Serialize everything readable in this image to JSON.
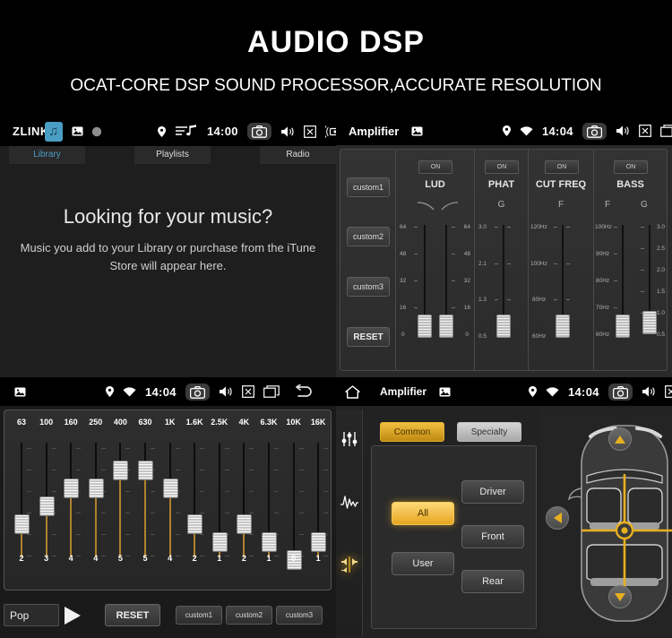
{
  "header": {
    "title": "AUDIO  DSP",
    "subtitle": "OCAT-CORE DSP SOUND PROCESSOR,ACCURATE RESOLUTION"
  },
  "colors": {
    "accent_gold": "#e7a520",
    "accent_blue": "#4a9ec4",
    "panel_bg": "#2b2b2b",
    "status_bg": "#000000",
    "fader_gold": "#b0822e"
  },
  "panel_music": {
    "app_name": "ZLINK",
    "badge_icon": "music-note-icon",
    "statusbar": {
      "time": "14:00",
      "icons": [
        "image-icon",
        "record-dot-icon",
        "location-pin-icon",
        "playlist-icon",
        "camera-icon",
        "speaker-icon",
        "close-box-icon",
        "radio-icon",
        "eject-icon"
      ]
    },
    "tabs": [
      {
        "label": "Library",
        "active": true
      },
      {
        "label": "Playlists",
        "active": false
      },
      {
        "label": "Radio",
        "active": false
      }
    ],
    "empty_state": {
      "heading": "Looking for your music?",
      "body": "Music you add to your Library or purchase from the iTune Store will appear here."
    }
  },
  "panel_dsp": {
    "title": "Amplifier",
    "statusbar": {
      "time": "14:04",
      "icons": [
        "image-icon",
        "location-pin-icon",
        "wifi-icon",
        "camera-icon",
        "speaker-icon",
        "close-box-icon",
        "window-icon"
      ]
    },
    "presets": [
      "custom1",
      "custom2",
      "custom3"
    ],
    "reset_label": "RESET",
    "on_label": "ON",
    "columns": [
      {
        "name": "LUD",
        "on": "ON",
        "units": [],
        "faders": [
          {
            "unit": "",
            "scale": [
              "64",
              "48",
              "32",
              "16",
              "0"
            ],
            "value_pct": 4
          },
          {
            "unit": "",
            "scale": [
              "64",
              "48",
              "32",
              "16",
              "0"
            ],
            "value_pct": 4
          }
        ]
      },
      {
        "name": "PHAT",
        "on": "ON",
        "units": [
          "G"
        ],
        "faders": [
          {
            "unit": "G",
            "scale": [
              "3.0",
              "2.1",
              "1.3",
              "0.5"
            ],
            "value_pct": 5
          }
        ]
      },
      {
        "name": "CUT FREQ",
        "on": "ON",
        "units": [
          "F"
        ],
        "faders": [
          {
            "unit": "F",
            "scale": [
              "120Hz",
              "100Hz",
              "80Hz",
              "60Hz"
            ],
            "value_pct": 5
          }
        ]
      },
      {
        "name": "BASS",
        "on": "ON",
        "units": [
          "F",
          "G"
        ],
        "faders": [
          {
            "unit": "F",
            "scale": [
              "100Hz",
              "90Hz",
              "80Hz",
              "70Hz",
              "60Hz"
            ],
            "value_pct": 5
          },
          {
            "unit": "G",
            "scale": [
              "3.0",
              "2.5",
              "2.0",
              "1.5",
              "1.0",
              "0.5"
            ],
            "value_pct": 8
          }
        ]
      }
    ]
  },
  "panel_eq": {
    "statusbar": {
      "time": "14:04",
      "icons": [
        "image-icon",
        "location-pin-icon",
        "wifi-icon",
        "camera-icon",
        "speaker-icon",
        "close-box-icon",
        "window-icon",
        "back-arrow-icon"
      ]
    },
    "bands": [
      {
        "freq": "63",
        "value": "2"
      },
      {
        "freq": "100",
        "value": "3"
      },
      {
        "freq": "160",
        "value": "4"
      },
      {
        "freq": "250",
        "value": "4"
      },
      {
        "freq": "400",
        "value": "5"
      },
      {
        "freq": "630",
        "value": "5"
      },
      {
        "freq": "1K",
        "value": "4"
      },
      {
        "freq": "1.6K",
        "value": "2"
      },
      {
        "freq": "2.5K",
        "value": "1"
      },
      {
        "freq": "4K",
        "value": "2"
      },
      {
        "freq": "6.3K",
        "value": "1"
      },
      {
        "freq": "10K",
        "value": "0"
      },
      {
        "freq": "16K",
        "value": "1"
      }
    ],
    "preset_value": "Pop",
    "play_icon": "play-triangle-icon",
    "reset_label": "RESET",
    "customs": [
      "custom1",
      "custom2",
      "custom3"
    ]
  },
  "panel_amp": {
    "title": "Amplifier",
    "home_icon": "home-icon",
    "statusbar": {
      "time": "14:04",
      "icons": [
        "home-icon",
        "image-icon",
        "location-pin-icon",
        "wifi-icon",
        "camera-icon",
        "speaker-icon",
        "close-box-icon"
      ]
    },
    "sidebar_icons": [
      "equalizer-sliders-icon",
      "waveform-icon",
      "balance-speaker-icon"
    ],
    "tabs": [
      {
        "label": "Common",
        "active": true
      },
      {
        "label": "Specialty",
        "active": false
      }
    ],
    "buttons": [
      {
        "label": "All",
        "active": true
      },
      {
        "label": "User",
        "active": false
      },
      {
        "label": "Driver",
        "active": false
      },
      {
        "label": "Front",
        "active": false
      },
      {
        "label": "Rear",
        "active": false
      }
    ],
    "car_diagram": {
      "name": "car-seat-balance-diagram",
      "nav_up_icon": "chevron-up-icon",
      "nav_down_icon": "chevron-down-icon",
      "nav_left_icon": "chevron-left-icon",
      "center_icon": "crosshair-icon"
    }
  }
}
